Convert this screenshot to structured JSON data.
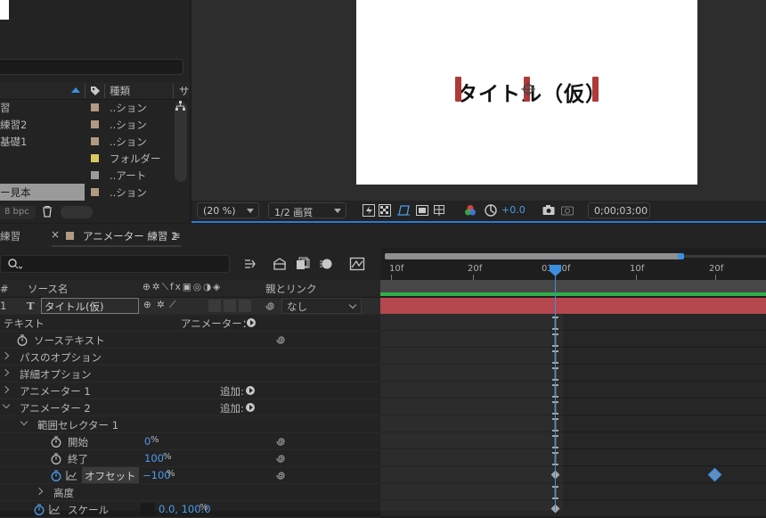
{
  "project": {
    "type_header": "種類",
    "s_header": "サ",
    "rows": [
      {
        "name": "習",
        "type": "..ション",
        "color": "#b09a80"
      },
      {
        "name": "練習2",
        "type": "..ション",
        "color": "#b09a80"
      },
      {
        "name": "基礎1",
        "type": "..ション",
        "color": "#b09a80"
      },
      {
        "name": "",
        "type": "フォルダー",
        "color": "#d8c860"
      },
      {
        "name": "",
        "type": "..アート",
        "color": "#9a9aa0"
      },
      {
        "name": "ー見本",
        "type": "..ション",
        "color": "#b09a80"
      }
    ],
    "bpc": "8 bpc"
  },
  "viewer": {
    "title": "タイトル（仮）",
    "zoom": "(20 %)",
    "resolution": "1/2 画質",
    "exposure": "+0.0",
    "timecode": "0;00;03;00"
  },
  "tabs": {
    "prev": "練習",
    "active": "アニメーター 練習 2",
    "menu_icon": "≡"
  },
  "columns": {
    "num": "#",
    "source": "ソース名",
    "parent": "親とリンク"
  },
  "layer": {
    "num": "1",
    "type_glyph": "T",
    "name": "タイトル(仮)",
    "parent": "なし"
  },
  "props": {
    "text": "テキスト",
    "animator_label": "アニメーター：",
    "source_text": "ソーステキスト",
    "path_options": "パスのオプション",
    "more_options": "詳細オプション",
    "animator1": "アニメーター 1",
    "animator2": "アニメーター 2",
    "add1": "追加:",
    "add2": "追加:",
    "range_selector": "範囲セレクター 1",
    "start": "開始",
    "start_val": "0",
    "end": "終了",
    "end_val": "100",
    "offset": "オフセット",
    "offset_val": "−100",
    "pct": "%",
    "height": "高度",
    "scale": "スケール",
    "scale_val": "0.0, 100.0"
  },
  "ruler": {
    "ticks": [
      "10f",
      "20f",
      "03:00f",
      "10f",
      "20f"
    ]
  },
  "colors": {
    "accent": "#3b8fe0",
    "layer_bar": "#b4484e",
    "green_bar": "#2fb04a"
  }
}
